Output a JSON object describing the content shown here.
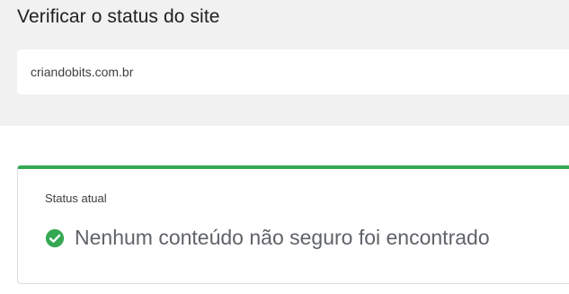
{
  "header": {
    "title": "Verificar o status do site"
  },
  "search": {
    "value": "criandobits.com.br"
  },
  "status": {
    "label": "Status atual",
    "message": "Nenhum conteúdo não seguro foi encontrado",
    "icon": "check-circle-icon"
  },
  "colors": {
    "accent_green": "#34a853",
    "panel_background": "#f1f1f1"
  }
}
